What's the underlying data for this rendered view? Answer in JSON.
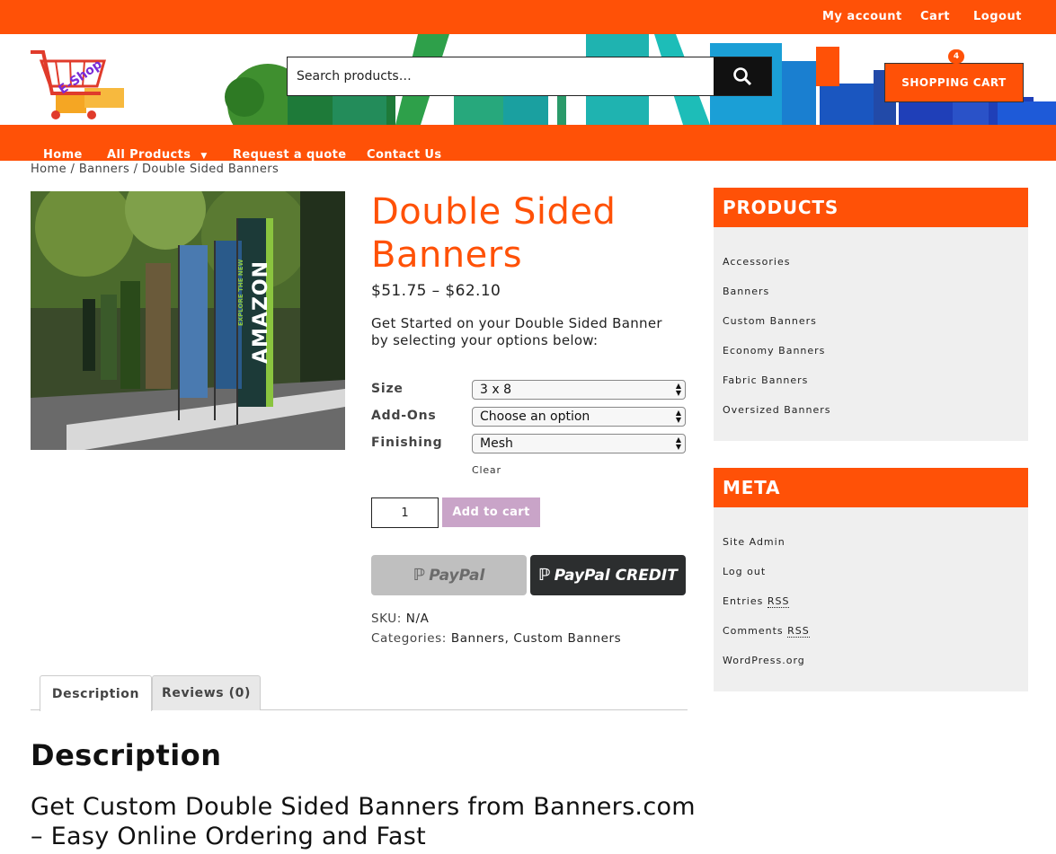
{
  "topbar": {
    "links": [
      "My account",
      "Cart",
      "Logout"
    ]
  },
  "logo": {
    "text": "E-Shop"
  },
  "search": {
    "placeholder": "Search products…"
  },
  "cart": {
    "label": "SHOPPING CART",
    "count": "4"
  },
  "nav": {
    "items": [
      "Home",
      "All Products",
      "Request a quote",
      "Contact Us"
    ]
  },
  "breadcrumb": {
    "text": "Home / Banners / Double Sided Banners"
  },
  "product": {
    "title": "Double Sided Banners",
    "price": "$51.75 – $62.10",
    "intro": "Get Started on your Double Sided Banner by selecting your options below:",
    "options": [
      {
        "label": "Size",
        "value": "3 x 8"
      },
      {
        "label": "Add-Ons",
        "value": "Choose an option"
      },
      {
        "label": "Finishing",
        "value": "Mesh"
      }
    ],
    "clear_label": "Clear",
    "quantity": "1",
    "add_to_cart": "Add to cart",
    "paypal_label": "PayPal",
    "paypal_credit_label": "PayPal CREDIT",
    "sku_label": "SKU:",
    "sku_value": "N/A",
    "categories_label": "Categories:",
    "categories_value": "Banners, Custom Banners",
    "image_banner_text": "AMAZON",
    "image_banner_small": "EXPLORE THE NEW"
  },
  "tabs": [
    "Description",
    "Reviews (0)"
  ],
  "description": {
    "heading": "Description",
    "subheading": "Get Custom Double Sided Banners from Banners.com – Easy Online Ordering and Fast"
  },
  "sidebar": {
    "products": {
      "title": "PRODUCTS",
      "items": [
        "Accessories",
        "Banners",
        "Custom Banners",
        "Economy Banners",
        "Fabric Banners",
        "Oversized Banners"
      ]
    },
    "meta": {
      "title": "META",
      "items": [
        "Site Admin",
        "Log out",
        "Entries",
        "Comments",
        "WordPress.org"
      ],
      "rss": "RSS"
    }
  },
  "colors": {
    "accent": "#ff5107",
    "add_to_cart": "#c9a4c8",
    "paypal_dark": "#2c2e2f"
  }
}
